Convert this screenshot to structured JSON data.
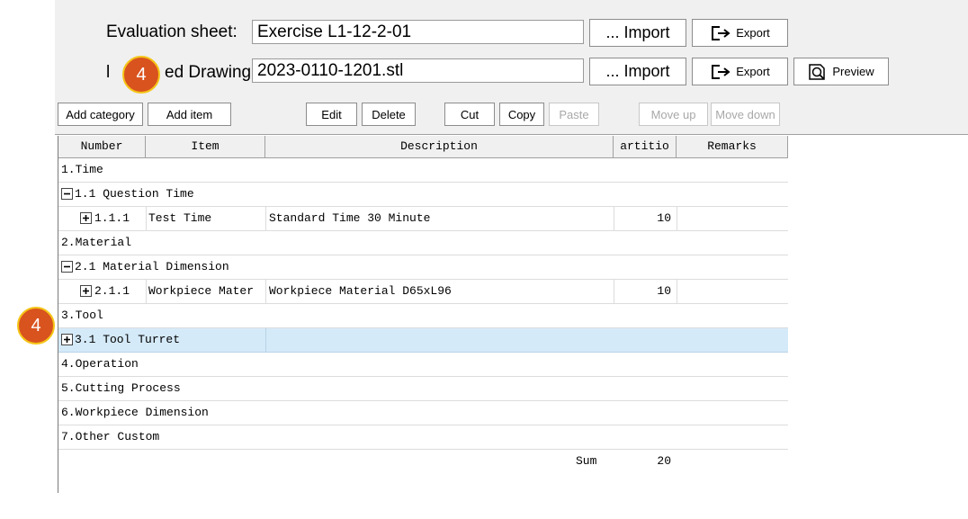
{
  "header": {
    "evaluation_label": "Evaluation sheet:",
    "evaluation_value": "Exercise L1-12-2-01",
    "drawing_label_visible": "ed Drawing:",
    "drawing_value": "2023-0110-1201.stl",
    "import_label": "... Import",
    "export_label": "Export",
    "preview_label": "Preview"
  },
  "toolbar": {
    "add_category": "Add category",
    "add_item": "Add item",
    "edit": "Edit",
    "delete": "Delete",
    "cut": "Cut",
    "copy": "Copy",
    "paste": "Paste",
    "move_up": "Move up",
    "move_down": "Move down"
  },
  "table": {
    "columns": [
      "Number",
      "Item",
      "Description",
      "artitio",
      "Remarks"
    ],
    "rows": [
      {
        "number": "1.Time"
      },
      {
        "number": "1.1 Question Time",
        "toggle": "minus"
      },
      {
        "number": "1.1.1",
        "toggle": "plus",
        "item": "Test Time",
        "description": "Standard Time 30 Minute",
        "partition": "10"
      },
      {
        "number": "2.Material"
      },
      {
        "number": "2.1 Material Dimension",
        "toggle": "minus"
      },
      {
        "number": "2.1.1",
        "toggle": "plus",
        "item": "Workpiece Mater",
        "description": "Workpiece Material D65xL96",
        "partition": "10"
      },
      {
        "number": "3.Tool"
      },
      {
        "number": "3.1 Tool Turret",
        "toggle": "plus",
        "selected": true
      },
      {
        "number": "4.Operation"
      },
      {
        "number": "5.Cutting Process"
      },
      {
        "number": "6.Workpiece Dimension"
      },
      {
        "number": "7.Other Custom"
      }
    ],
    "sum_label": "Sum",
    "sum_value": "20"
  },
  "badges": {
    "badge_1": "4",
    "badge_2": "4"
  }
}
